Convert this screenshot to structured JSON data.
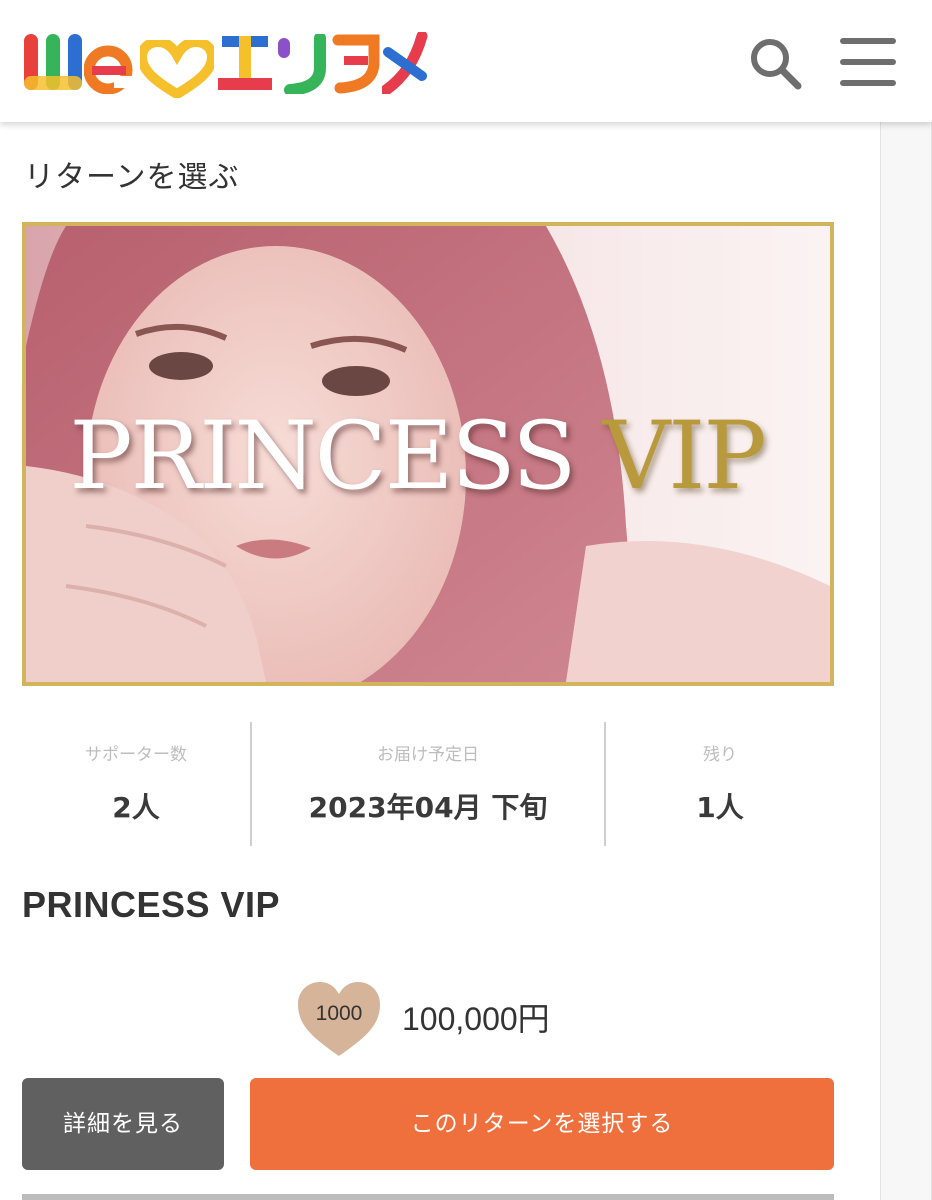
{
  "header": {
    "logo": {
      "text": "We♡エンタメ",
      "chars": [
        {
          "c": "W",
          "color": "#e8413b"
        },
        {
          "c": "e",
          "color": "#f07a24"
        },
        {
          "c": "エ",
          "color": "#2c6fd0"
        },
        {
          "c": "ン",
          "color": "#35b45a"
        },
        {
          "c": "タ",
          "color": "#8c51c8"
        },
        {
          "c": "メ",
          "color": "#e63c4c"
        }
      ],
      "heart_color": "#f6c02d"
    },
    "search_icon": "search-icon",
    "menu_icon": "hamburger-menu-icon"
  },
  "section_title": "リターンを選ぶ",
  "hero": {
    "title_white": "PRINCESS",
    "title_gold": "VIP",
    "border_color": "#d2b45c"
  },
  "stats": [
    {
      "label": "サポーター数",
      "value": "2人"
    },
    {
      "label": "お届け予定日",
      "value": "2023年04月 下旬"
    },
    {
      "label": "残り",
      "value": "1人"
    }
  ],
  "reward": {
    "title": "PRINCESS VIP",
    "heart_points": "1000",
    "price": "100,000円"
  },
  "buttons": {
    "detail": "詳細を見る",
    "select": "このリターンを選択する"
  },
  "colors": {
    "accent": "#ef6f3d",
    "detail_button": "#606060",
    "heart": "#d6b49a"
  }
}
